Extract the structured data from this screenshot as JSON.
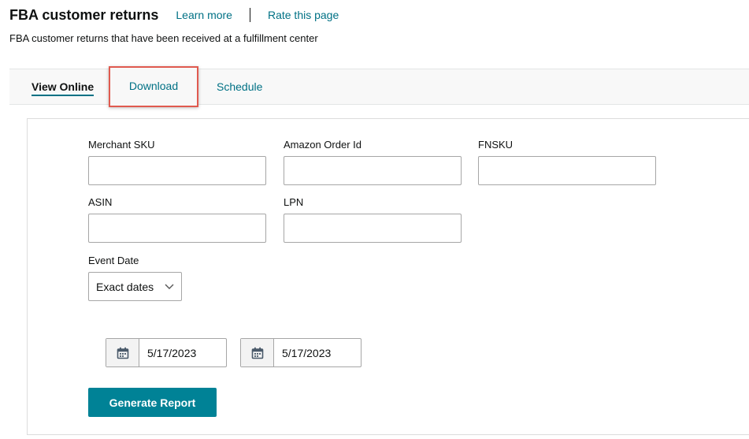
{
  "header": {
    "title": "FBA customer returns",
    "learn_more": "Learn more",
    "rate_page": "Rate this page",
    "subtitle": "FBA customer returns that have been received at a fulfillment center"
  },
  "tabs": [
    {
      "label": "View Online",
      "active": true
    },
    {
      "label": "Download",
      "active": false,
      "highlighted": true
    },
    {
      "label": "Schedule",
      "active": false
    }
  ],
  "form": {
    "merchant_sku": {
      "label": "Merchant SKU",
      "value": ""
    },
    "amazon_order_id": {
      "label": "Amazon Order Id",
      "value": ""
    },
    "fnsku": {
      "label": "FNSKU",
      "value": ""
    },
    "asin": {
      "label": "ASIN",
      "value": ""
    },
    "lpn": {
      "label": "LPN",
      "value": ""
    },
    "event_date": {
      "label": "Event Date",
      "selected": "Exact dates",
      "icon": "chevron-down-icon"
    },
    "start_date": {
      "value": "5/17/2023",
      "icon": "calendar-icon"
    },
    "end_date": {
      "value": "5/17/2023",
      "icon": "calendar-icon"
    },
    "generate_label": "Generate Report"
  },
  "colors": {
    "link": "#007185",
    "button": "#008296",
    "highlight_border": "#e05a4f",
    "tab_bar": "#f8f8f8"
  }
}
